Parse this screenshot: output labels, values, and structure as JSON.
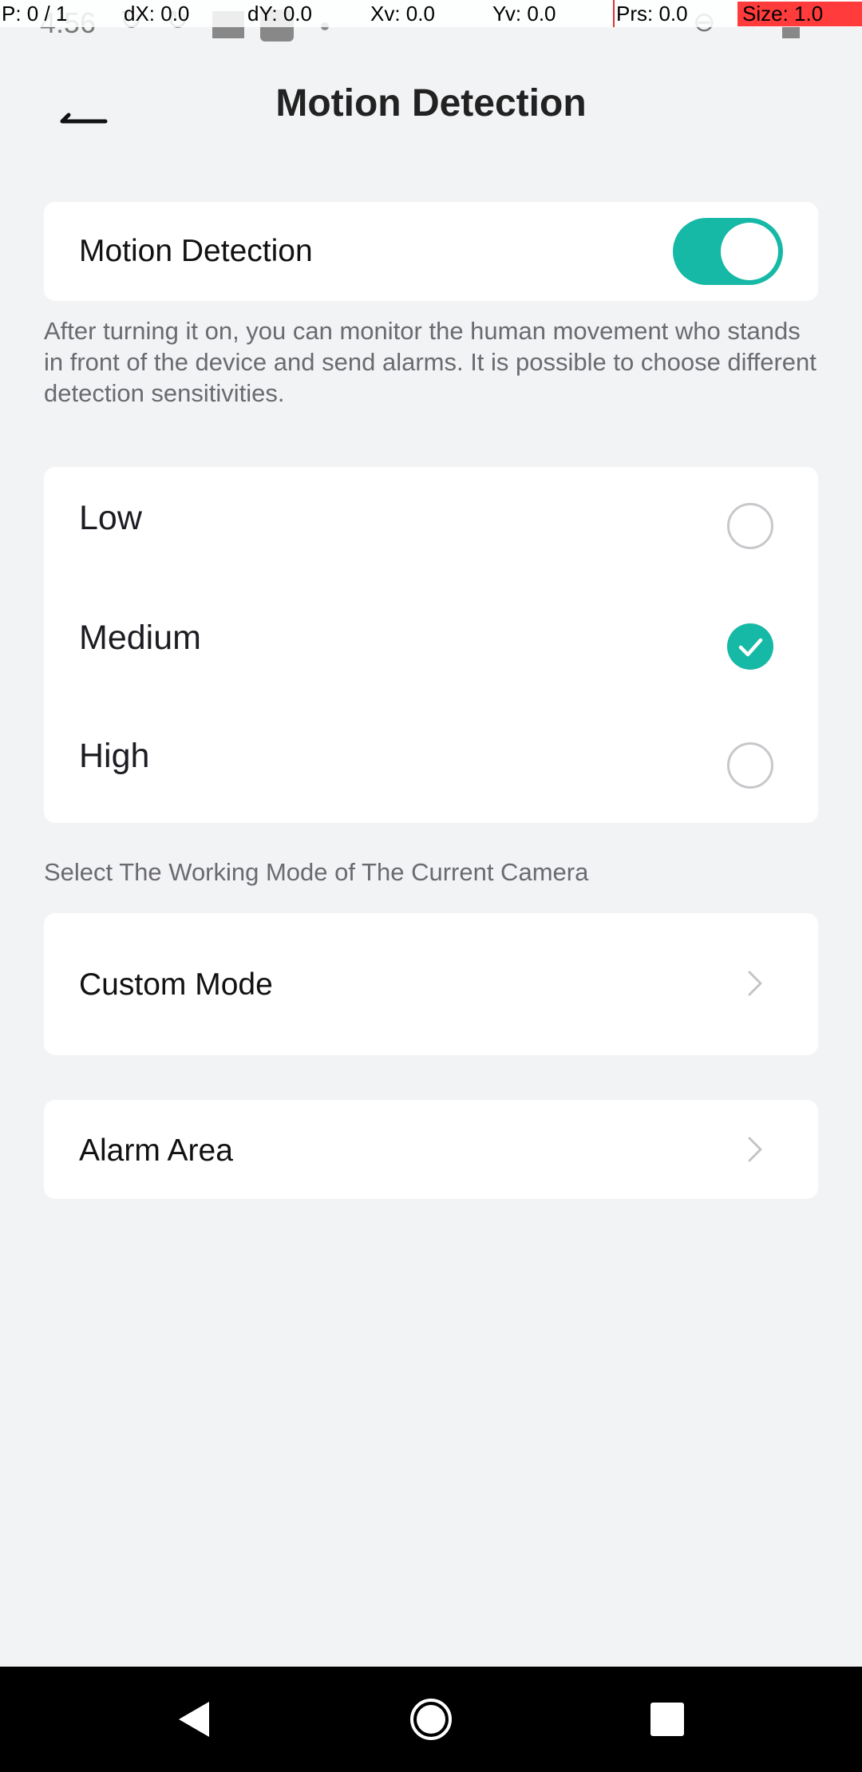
{
  "status_bar": {
    "time": "4:56"
  },
  "debug_overlay": {
    "p": "P: 0 / 1",
    "dx": "dX: 0.0",
    "dy": "dY: 0.0",
    "xv": "Xv: 0.0",
    "yv": "Yv: 0.0",
    "prs": "Prs: 0.0",
    "size": "Size: 1.0"
  },
  "header": {
    "title": "Motion Detection",
    "back_icon": "back-arrow-icon"
  },
  "motion_toggle": {
    "label": "Motion Detection",
    "enabled": true,
    "accent_color": "#16b8a6"
  },
  "description": "After turning it on, you can monitor the human movement who stands in front of the device and send alarms. It is possible to choose different detection sensitivities.",
  "sensitivity": {
    "options": [
      {
        "label": "Low",
        "selected": false
      },
      {
        "label": "Medium",
        "selected": true
      },
      {
        "label": "High",
        "selected": false
      }
    ]
  },
  "working_mode": {
    "caption": "Select The Working Mode of The Current Camera",
    "custom_mode_label": "Custom Mode"
  },
  "alarm_area": {
    "label": "Alarm Area"
  },
  "nav_bar": {
    "back_icon": "nav-back-icon",
    "home_icon": "nav-home-icon",
    "recents_icon": "nav-recents-icon"
  }
}
